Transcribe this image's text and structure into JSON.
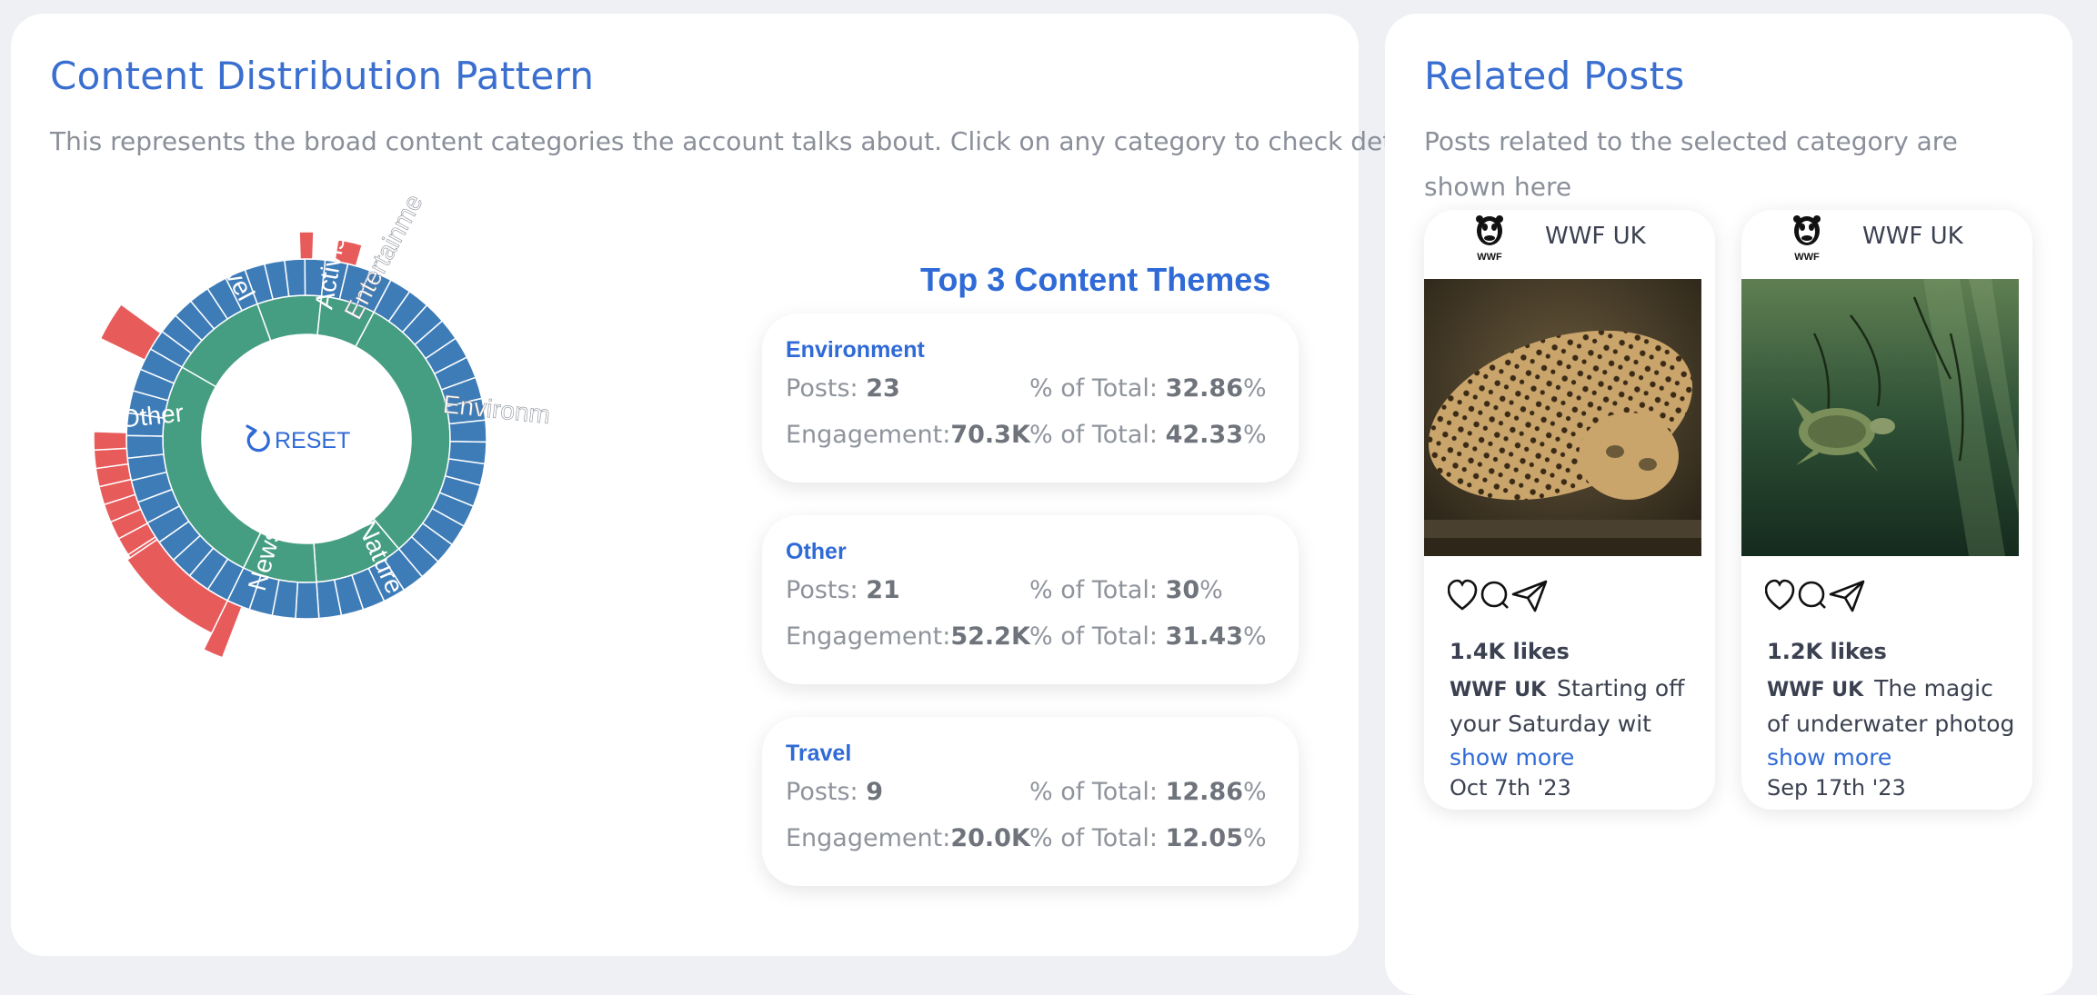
{
  "distribution": {
    "title": "Content Distribution Pattern",
    "subtitle": "This represents the broad content categories the account talks about. Click on any category to check details",
    "reset_label": "RESET",
    "segment_labels": [
      "Activism",
      "Entertainme",
      "Environm",
      "Nature",
      "News",
      "Other",
      "Travel"
    ]
  },
  "themes": {
    "title": "Top 3 Content Themes",
    "posts_label": "Posts: ",
    "engagement_label": "Engagement:",
    "total_label": "% of Total: ",
    "percent_sign": "%",
    "items": [
      {
        "name": "Environment",
        "posts": "23",
        "posts_pct": "32.86",
        "engagement": "70.3K",
        "engagement_pct": "42.33"
      },
      {
        "name": "Other",
        "posts": "21",
        "posts_pct": "30",
        "engagement": "52.2K",
        "engagement_pct": "31.43"
      },
      {
        "name": "Travel",
        "posts": "9",
        "posts_pct": "12.86",
        "engagement": "20.0K",
        "engagement_pct": "12.05"
      }
    ]
  },
  "related": {
    "title": "Related Posts",
    "subtitle": "Posts related to the selected category are shown here",
    "posts": [
      {
        "author": "WWF UK",
        "logo_text": "WWF",
        "likes": "1.4K likes",
        "caption_author": "WWF UK",
        "caption": "Starting off your Saturday wit ",
        "show_more": "show more",
        "date": "Oct 7th '23"
      },
      {
        "author": "WWF UK",
        "logo_text": "WWF",
        "likes": "1.2K likes",
        "caption_author": "WWF UK",
        "caption": "The magic of underwater photog ",
        "show_more": "show more",
        "date": "Sep 17th '23"
      }
    ]
  },
  "colors": {
    "accent": "#3a6fd0",
    "inner_ring": "#469e82",
    "middle_ring": "#3e7cb8",
    "outer_ring": "#e85b5b"
  }
}
